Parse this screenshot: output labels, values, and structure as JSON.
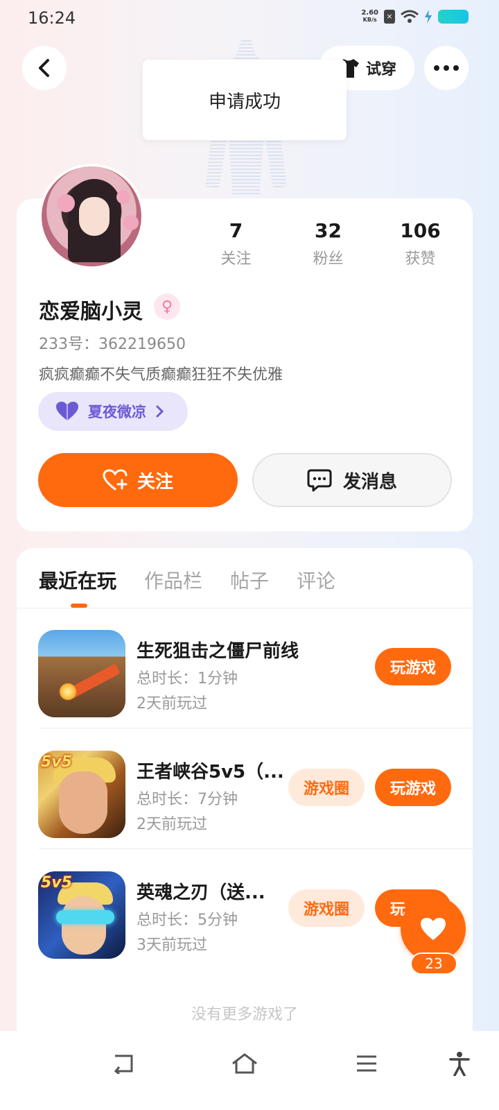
{
  "status_bar": {
    "time": "16:24",
    "net_speed_value": "2.60",
    "net_speed_unit": "KB/s"
  },
  "header": {
    "try_on_label": "试穿"
  },
  "toast": {
    "message": "申请成功"
  },
  "profile": {
    "stats": [
      {
        "value": "7",
        "label": "关注"
      },
      {
        "value": "32",
        "label": "粉丝"
      },
      {
        "value": "106",
        "label": "获赞"
      }
    ],
    "username": "恋爱脑小灵",
    "gender_symbol": "♀",
    "uid": "233号：362219650",
    "bio": "疯疯癫癫不失气质癫癫狂狂不失优雅",
    "tag_label": "夏夜微凉",
    "follow_label": "关注",
    "message_label": "发消息"
  },
  "tabs": [
    {
      "label": "最近在玩",
      "active": true
    },
    {
      "label": "作品栏",
      "active": false
    },
    {
      "label": "帖子",
      "active": false
    },
    {
      "label": "评论",
      "active": false
    }
  ],
  "games": [
    {
      "title": "生死狙击之僵尸前线",
      "duration": "总时长：1分钟",
      "last_played": "2天前玩过",
      "has_circle": false,
      "play_label": "玩游戏"
    },
    {
      "title": "王者峡谷5v5（...",
      "duration": "总时长：7分钟",
      "last_played": "2天前玩过",
      "has_circle": true,
      "circle_label": "游戏圈",
      "play_label": "玩游戏",
      "badge": "5v5"
    },
    {
      "title": "英魂之刃（送...",
      "duration": "总时长：5分钟",
      "last_played": "3天前玩过",
      "has_circle": true,
      "circle_label": "游戏圈",
      "play_label": "玩",
      "badge": "5v5"
    }
  ],
  "no_more_text": "没有更多游戏了",
  "like_fab": {
    "count": "23"
  },
  "colors": {
    "accent": "#ff6a0f",
    "tag_purple": "#6b5ad6",
    "gender_pink": "#f07aa0"
  },
  "icons": {
    "back": "back-arrow-icon",
    "more": "more-dots-icon",
    "try_on": "tshirt-icon",
    "follow": "heart-plus-icon",
    "message": "chat-bubble-icon",
    "tag": "heart-icon",
    "fab": "heart-icon"
  }
}
